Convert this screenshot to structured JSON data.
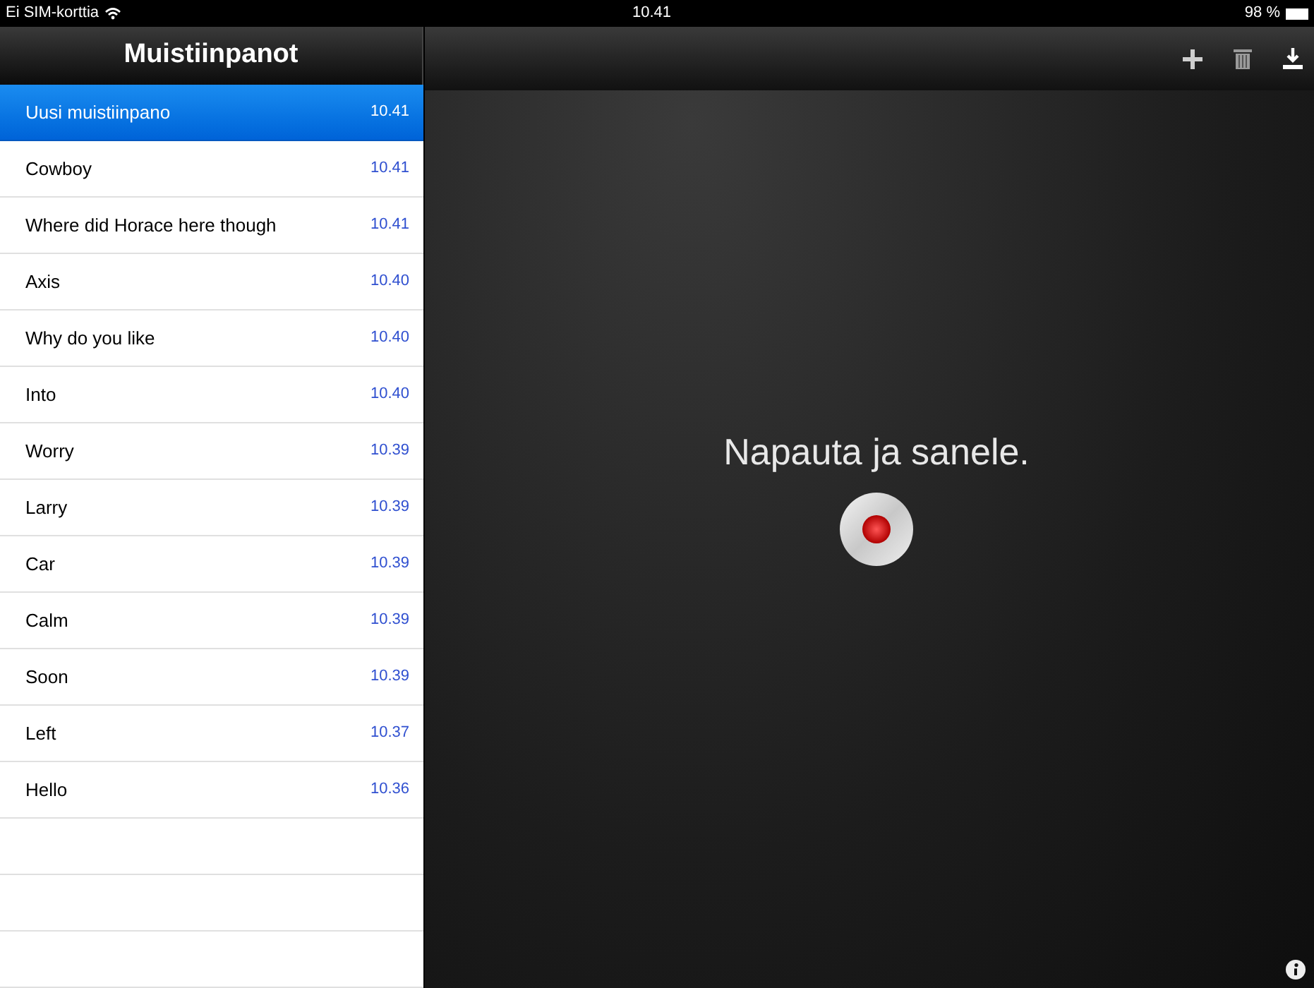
{
  "status_bar": {
    "carrier": "Ei SIM-korttia",
    "time": "10.41",
    "battery": "98 %"
  },
  "sidebar": {
    "title": "Muistiinpanot",
    "items": [
      {
        "label": "Uusi muistiinpano",
        "time": "10.41",
        "selected": true
      },
      {
        "label": "Cowboy",
        "time": "10.41",
        "selected": false
      },
      {
        "label": "Where did Horace here though",
        "time": "10.41",
        "selected": false
      },
      {
        "label": "Axis",
        "time": "10.40",
        "selected": false
      },
      {
        "label": "Why do you like",
        "time": "10.40",
        "selected": false
      },
      {
        "label": "Into",
        "time": "10.40",
        "selected": false
      },
      {
        "label": "Worry",
        "time": "10.39",
        "selected": false
      },
      {
        "label": "Larry",
        "time": "10.39",
        "selected": false
      },
      {
        "label": "Car",
        "time": "10.39",
        "selected": false
      },
      {
        "label": "Calm",
        "time": "10.39",
        "selected": false
      },
      {
        "label": "Soon",
        "time": "10.39",
        "selected": false
      },
      {
        "label": "Left",
        "time": "10.37",
        "selected": false
      },
      {
        "label": "Hello",
        "time": "10.36",
        "selected": false
      }
    ]
  },
  "main": {
    "prompt": "Napauta ja sanele."
  }
}
